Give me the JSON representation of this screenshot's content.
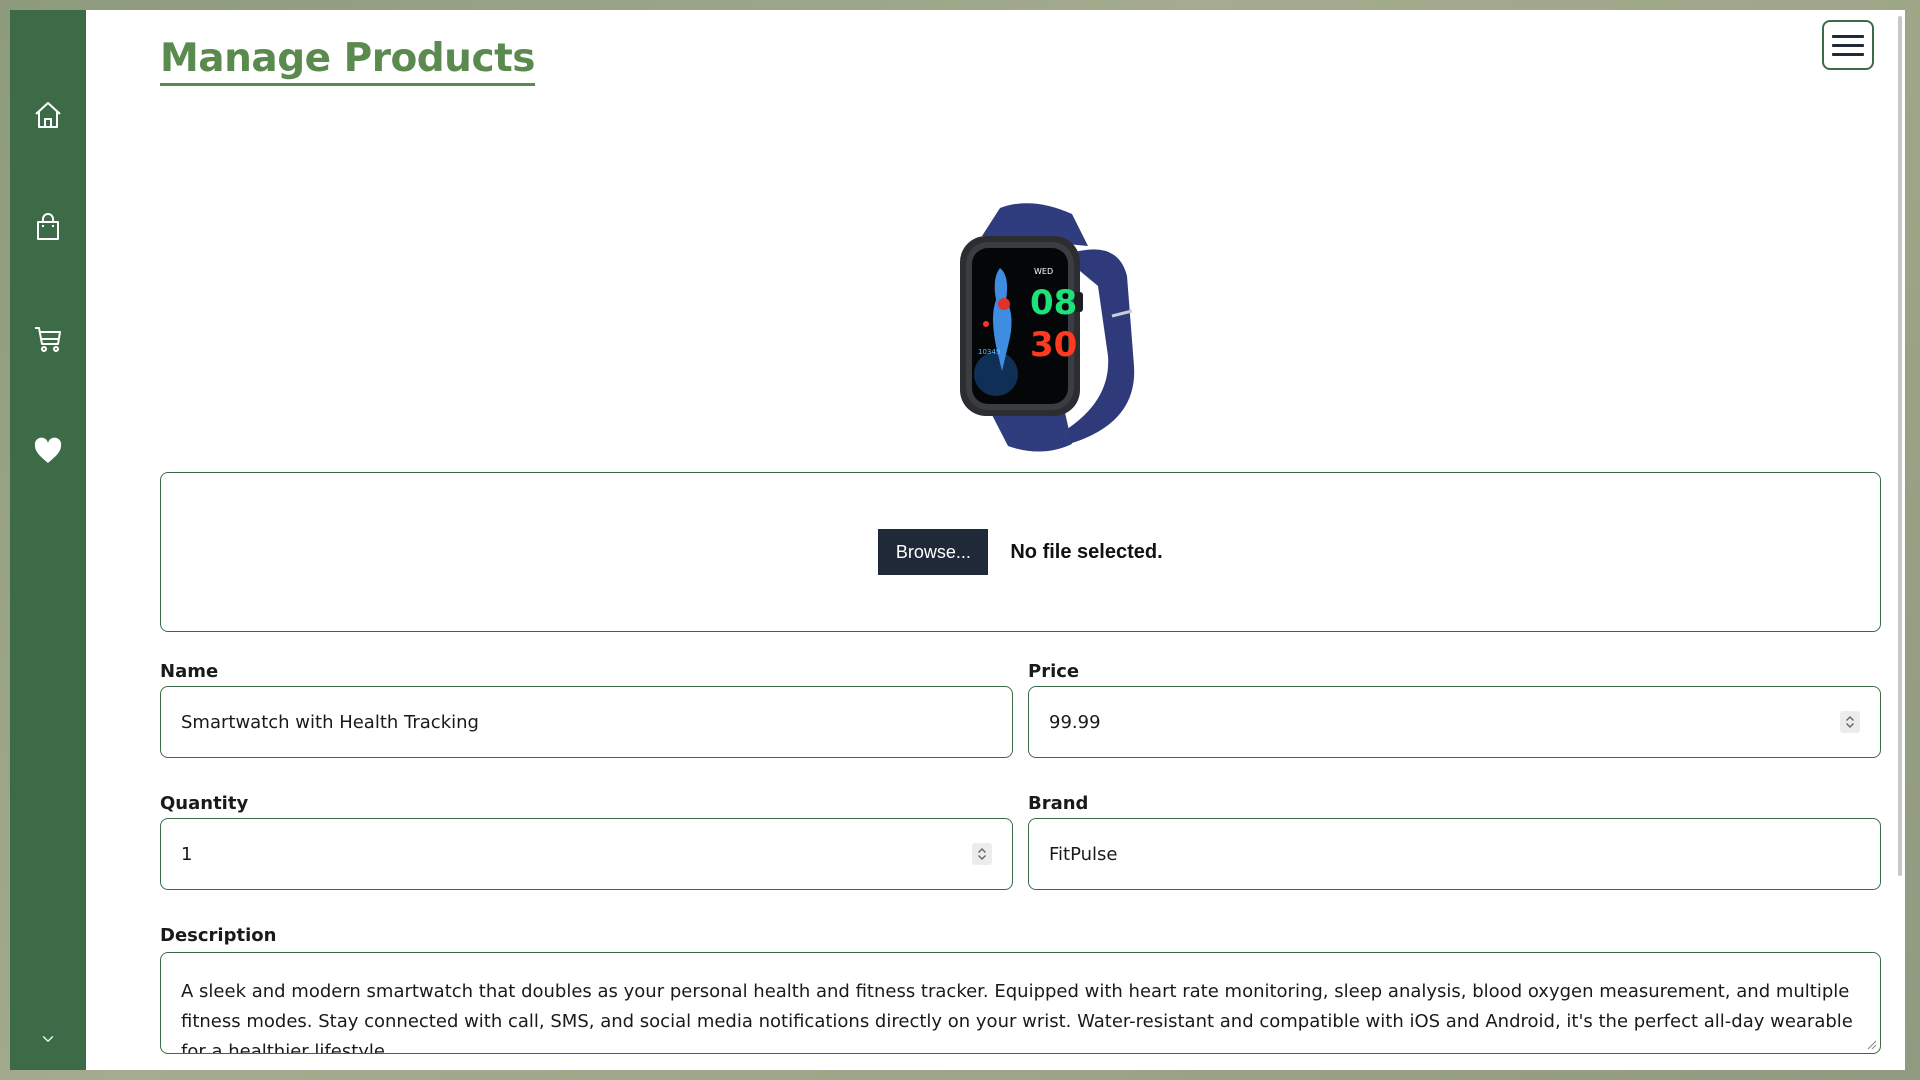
{
  "page": {
    "title": "Manage Products"
  },
  "sidebar": {
    "items": [
      {
        "icon": "home-icon"
      },
      {
        "icon": "shopping-bag-icon"
      },
      {
        "icon": "shopping-cart-icon"
      },
      {
        "icon": "heart-icon"
      }
    ],
    "expand_icon": "chevron-down-icon"
  },
  "header": {
    "menu_icon": "hamburger-menu-icon"
  },
  "upload": {
    "browse_label": "Browse...",
    "status": "No file selected."
  },
  "form": {
    "name": {
      "label": "Name",
      "value": "Smartwatch with Health Tracking"
    },
    "price": {
      "label": "Price",
      "value": "99.99"
    },
    "quantity": {
      "label": "Quantity",
      "value": "1"
    },
    "brand": {
      "label": "Brand",
      "value": "FitPulse"
    },
    "description": {
      "label": "Description",
      "value": "A sleek and modern smartwatch that doubles as your personal health and fitness tracker. Equipped with heart rate monitoring, sleep analysis, blood oxygen measurement, and multiple fitness modes. Stay connected with call, SMS, and social media notifications directly on your wrist. Water-resistant and compatible with iOS and Android, it's the perfect all-day wearable for a healthier lifestyle."
    }
  },
  "colors": {
    "sidebar": "#3d6b47",
    "accent": "#5b8a4e",
    "button_dark": "#1f2937"
  }
}
